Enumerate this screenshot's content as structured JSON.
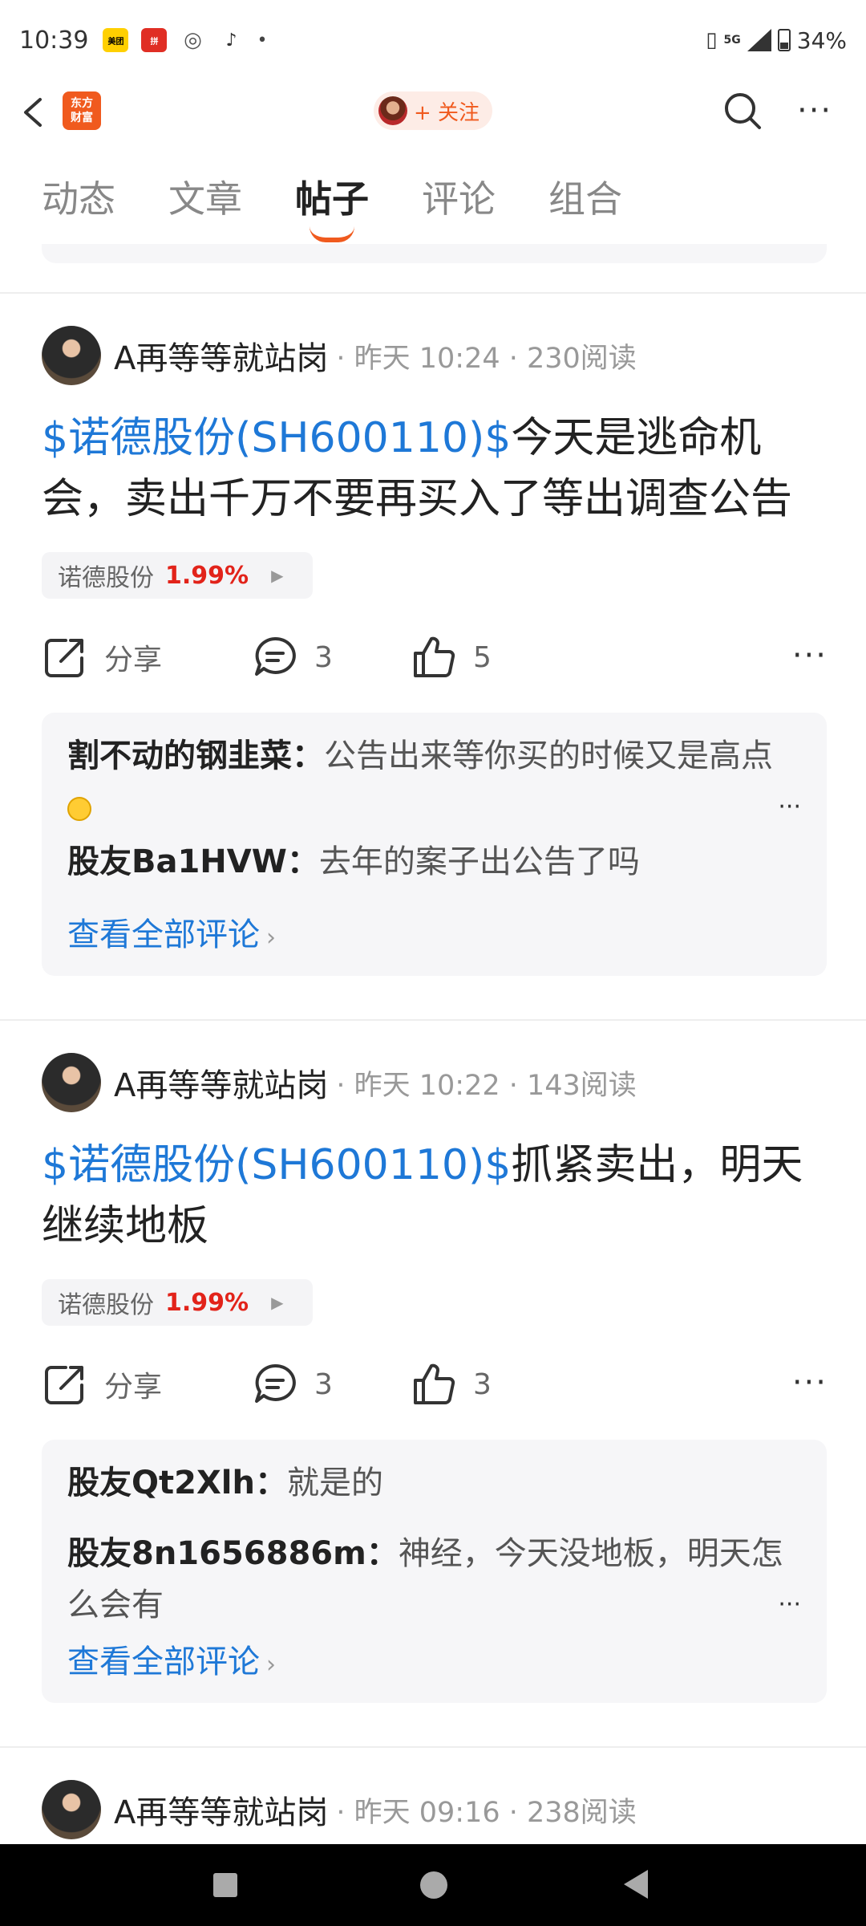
{
  "status_bar": {
    "time": "10:39",
    "apps": [
      "美团",
      "拼",
      "wechat-icon",
      "tiktok-icon",
      "•"
    ],
    "network": "5G",
    "battery": "34%"
  },
  "nav": {
    "follow_label": "+ 关注",
    "logo_line1": "东方",
    "logo_line2": "财富"
  },
  "tabs": [
    {
      "label": "动态"
    },
    {
      "label": "文章"
    },
    {
      "label": "帖子",
      "active": true
    },
    {
      "label": "评论"
    },
    {
      "label": "组合"
    }
  ],
  "posts": [
    {
      "author": "A再等等就站岗",
      "meta": "· 昨天 10:24 · 230阅读",
      "stock_tag": "$诺德股份(SH600110)$",
      "text": "今天是逃命机会，卖出千万不要再买入了等出调查公告",
      "chip_name": "诺德股份",
      "chip_change": "1.99%",
      "share_label": "分享",
      "comment_count": "3",
      "like_count": "5",
      "comments": [
        {
          "user": "割不动的钢韭菜：",
          "text": "公告出来等你买的时候又是高点"
        },
        {
          "user": "股友Ba1HVW：",
          "text": "去年的案子出公告了吗"
        }
      ],
      "view_all": "查看全部评论"
    },
    {
      "author": "A再等等就站岗",
      "meta": "· 昨天 10:22 · 143阅读",
      "stock_tag": "$诺德股份(SH600110)$",
      "text": "抓紧卖出，明天继续地板",
      "chip_name": "诺德股份",
      "chip_change": "1.99%",
      "share_label": "分享",
      "comment_count": "3",
      "like_count": "3",
      "comments": [
        {
          "user": "股友Qt2Xlh：",
          "text": "就是的"
        },
        {
          "user": "股友8n1656886m：",
          "text": "神经，今天没地板，明天怎么会有"
        }
      ],
      "view_all": "查看全部评论"
    },
    {
      "author": "A再等等就站岗",
      "meta": "· 昨天 09:16 · 238阅读"
    }
  ],
  "colors": {
    "accent": "#f05a1e",
    "link": "#1e78d7",
    "up": "#e2231a"
  }
}
